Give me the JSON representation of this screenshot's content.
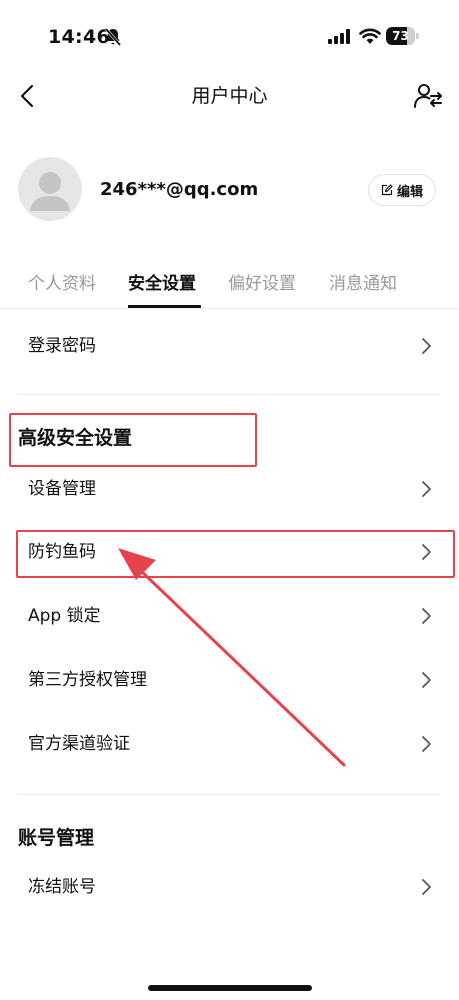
{
  "status_bar": {
    "time": "14:46",
    "battery": "73",
    "battery_level": 0.73
  },
  "nav": {
    "title": "用户中心"
  },
  "profile": {
    "email": "246***@qq.com",
    "edit_label": "编辑"
  },
  "tabs": [
    {
      "label": "个人资料",
      "active": false
    },
    {
      "label": "安全设置",
      "active": true
    },
    {
      "label": "偏好设置",
      "active": false
    },
    {
      "label": "消息通知",
      "active": false
    }
  ],
  "security": {
    "login_password": "登录密码",
    "advanced_title": "高级安全设置",
    "advanced_items": [
      "设备管理",
      "防钓鱼码",
      "App 锁定",
      "第三方授权管理",
      "官方渠道验证"
    ],
    "account_title": "账号管理",
    "account_items": [
      "冻结账号"
    ]
  },
  "colors": {
    "annotation": "#e8434a",
    "text_primary": "#111111",
    "text_muted": "#9a9a9a"
  }
}
